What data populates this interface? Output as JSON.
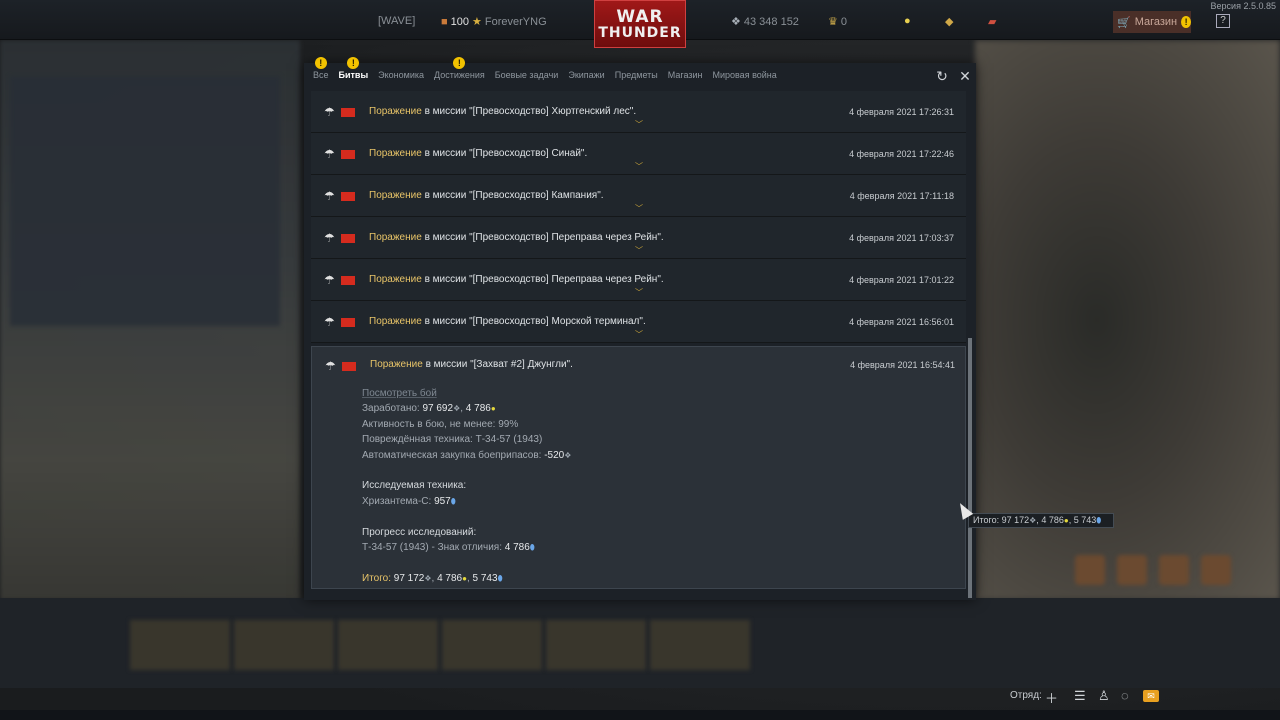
{
  "version": "Версия 2.5.0.85",
  "topbar": {
    "squadron": "[WAVE]",
    "level": "100",
    "username": "ForeverYNG",
    "silver_lions": "43 348 152",
    "golden_eagles": "0",
    "logo_line1": "WAR",
    "logo_line2": "THUNDER",
    "shop_label": "Магазин",
    "help_label": "?"
  },
  "window": {
    "tabs": [
      {
        "label": "Все",
        "badge": "!"
      },
      {
        "label": "Битвы",
        "badge": "!"
      },
      {
        "label": "Экономика",
        "badge": ""
      },
      {
        "label": "Достижения",
        "badge": "!"
      },
      {
        "label": "Боевые задачи",
        "badge": ""
      },
      {
        "label": "Экипажи",
        "badge": ""
      },
      {
        "label": "Предметы",
        "badge": ""
      },
      {
        "label": "Магазин",
        "badge": ""
      },
      {
        "label": "Мировая война",
        "badge": ""
      }
    ],
    "refresh_icon": "refresh-icon",
    "close_icon": "close-icon"
  },
  "rows": [
    {
      "result": "Поражение",
      "text": " в миссии \"[Превосходство] Хюртгенский лес\".",
      "date": "4 февраля 2021 17:26:31"
    },
    {
      "result": "Поражение",
      "text": " в миссии \"[Превосходство] Синай\".",
      "date": "4 февраля 2021 17:22:46"
    },
    {
      "result": "Поражение",
      "text": " в миссии \"[Превосходство] Кампания\".",
      "date": "4 февраля 2021 17:11:18"
    },
    {
      "result": "Поражение",
      "text": " в миссии \"[Превосходство] Переправа через Рейн\".",
      "date": "4 февраля 2021 17:03:37"
    },
    {
      "result": "Поражение",
      "text": " в миссии \"[Превосходство] Переправа через Рейн\".",
      "date": "4 февраля 2021 17:01:22"
    },
    {
      "result": "Поражение",
      "text": " в миссии \"[Превосходство] Морской терминал\".",
      "date": "4 февраля 2021 16:56:01"
    }
  ],
  "expanded": {
    "result": "Поражение",
    "text": " в миссии \"[Захват #2] Джунгли\".",
    "date": "4 февраля 2021 16:54:41",
    "view_battle": "Посмотреть бой",
    "earned_label": "Заработано: ",
    "earned_sl": "97 692",
    "earned_rp": "4 786",
    "activity": "Активность в бою, не менее: 99%",
    "damaged": "Повреждённая техника: Т-34-57 (1943)",
    "ammo_label": "Автоматическая закупка боеприпасов: ",
    "ammo_value": "-520",
    "research_title": "Исследуемая техника:",
    "research_vehicle": "Хризантема-С: ",
    "research_value": "957",
    "progress_title": "Прогресс исследований:",
    "progress_item": "Т-34-57 (1943) - Знак отличия: ",
    "progress_value": "4 786",
    "total_label": "Итого: ",
    "total_sl": "97 172",
    "total_rp": "4 786",
    "total_xp": "5 743"
  },
  "tooltip": {
    "label": "Итого: ",
    "sl": "97 172",
    "rp": "4 786",
    "xp": "5 743"
  },
  "bottom": {
    "squad_label": "Отряд:",
    "add_icon": "plus-icon",
    "list_icon": "list-icon",
    "friends_icon": "friends-icon",
    "chat_icon": "chat-icon",
    "mail_icon": "mail-icon"
  },
  "colors": {
    "loss": "#e8c468",
    "flag": "#d52b1e",
    "warning": "#f2c200",
    "logo_red": "#a01818"
  }
}
